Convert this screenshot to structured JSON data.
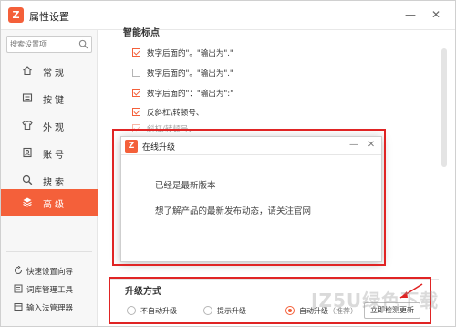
{
  "window": {
    "title": "属性设置",
    "logo_letter": "Z",
    "min_glyph": "—",
    "close_glyph": "✕"
  },
  "sidebar": {
    "search_placeholder": "搜索设置项",
    "items": [
      {
        "label": "常规",
        "icon": "home-icon",
        "active": false
      },
      {
        "label": "按键",
        "icon": "keyboard-icon",
        "active": false
      },
      {
        "label": "外观",
        "icon": "shirt-icon",
        "active": false
      },
      {
        "label": "账号",
        "icon": "account-icon",
        "active": false
      },
      {
        "label": "搜索",
        "icon": "search-icon",
        "active": false
      },
      {
        "label": "高级",
        "icon": "layers-icon",
        "active": true
      }
    ],
    "tools": [
      {
        "label": "快速设置向导",
        "icon": "wizard-icon"
      },
      {
        "label": "词库管理工具",
        "icon": "dictionary-icon"
      },
      {
        "label": "输入法管理器",
        "icon": "manager-icon"
      }
    ]
  },
  "content": {
    "smart_section_title": "智能标点",
    "options": [
      {
        "label": "数字后面的\"。\"输出为\".\"",
        "checked": true,
        "faded": false
      },
      {
        "label": "数字后面的\"。\"输出为\".\"",
        "checked": false,
        "faded": false
      },
      {
        "label": "数字后面的\"：\"输出为\":\"",
        "checked": true,
        "faded": false
      },
      {
        "label": "反斜杠\\转顿号、",
        "checked": true,
        "faded": false
      },
      {
        "label": "斜杠/转顿号、",
        "checked": true,
        "faded": true
      }
    ],
    "upgrade": {
      "title": "升级方式",
      "options": [
        {
          "label": "不自动升级",
          "checked": false
        },
        {
          "label": "提示升级",
          "checked": false
        },
        {
          "label": "自动升级",
          "recommend": "（推荐）",
          "checked": true
        }
      ],
      "check_button": "立即检测更新"
    }
  },
  "dialog": {
    "title": "在线升级",
    "logo_letter": "Z",
    "min_glyph": "—",
    "close_glyph": "✕",
    "message_1": "已经是最新版本",
    "message_2": "想了解产品的最新发布动态，请关注官网"
  },
  "watermark": "JZ5U绿色下载",
  "colors": {
    "accent": "#f4603a",
    "highlight": "#e02424"
  }
}
